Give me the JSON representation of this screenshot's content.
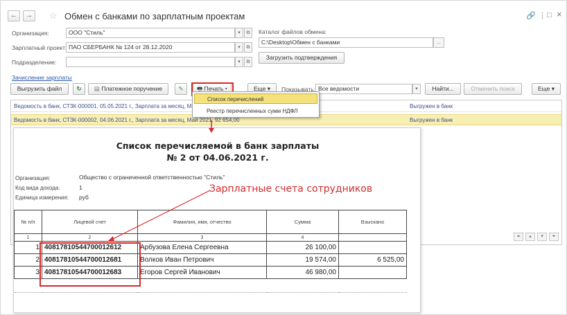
{
  "window": {
    "title": "Обмен с банками по зарплатным проектам",
    "back_icon": "←",
    "forward_icon": "→",
    "star_icon": "☆",
    "link_icon": "🔗",
    "more_icon": "⋮",
    "maximize_icon": "□",
    "close_icon": "×"
  },
  "form": {
    "org_label": "Организация:",
    "org_value": "ООО \"Стиль\"",
    "project_label": "Зарплатный проект:",
    "project_value": "ПАО СБЕРБАНК № 124 от 28.12.2020",
    "dept_label": "Подразделение:",
    "dept_value": "",
    "catalog_label": "Каталог файлов обмена:",
    "catalog_value": "C:\\Desktop\\Обмен с банками",
    "load_button": "Загрузить подтверждения",
    "section_link": "Зачисление зарплаты"
  },
  "toolbar": {
    "upload_button": "Выгрузить файл",
    "refresh_icon": "↻",
    "payment_button": "Платежное поручение",
    "edit_icon": "✎",
    "print_button": "Печать",
    "more_button": "Еще",
    "show_label": "Показывать:",
    "show_value": "Все ведомости",
    "find_button": "Найти...",
    "cancel_search_button": "Отменить поиск",
    "more_button2": "Еще"
  },
  "list": {
    "rows": [
      {
        "text": "Ведомость в банк, СТЗК-000001, 05.05.2021 г., Зарплата за месяц, Май 2021, 82 600,00",
        "status": "Выгружен в банк"
      },
      {
        "text": "Ведомость в банк, СТЗК-000002, 04.06.2021 г., Зарплата за месяц, Май 2021, 92 654,00",
        "status": "Выгружен в банк"
      }
    ]
  },
  "print_menu": {
    "items": [
      "Список перечислений",
      "Реестр перечисленных сумм НДФЛ"
    ]
  },
  "report": {
    "title_line1": "Список перечисляемой в банк зарплаты",
    "title_line2": "№  2 от 04.06.2021 г.",
    "org_label": "Организация:",
    "org_value": "Общество с ограниченной ответственностью \"Стиль\"",
    "income_label": "Код вида дохода:",
    "income_value": "1",
    "unit_label": "Единица измерения:",
    "unit_value": "руб",
    "headers": [
      "№ п/п",
      "Лицевой счет",
      "Фамилия, имя, отчество",
      "Сумма",
      "Взыскано"
    ],
    "col_numbers": [
      "1",
      "2",
      "3",
      "4",
      ""
    ],
    "rows": [
      {
        "n": "1",
        "account": "40817810544700012612",
        "name": "Арбузова Елена Сергеевна",
        "sum": "26 100,00",
        "withheld": ""
      },
      {
        "n": "2",
        "account": "40817810544700012681",
        "name": "Волков Иван Петрович",
        "sum": "19 574,00",
        "withheld": "6 525,00"
      },
      {
        "n": "3",
        "account": "40817810544700012683",
        "name": "Егоров Сергей Иванович",
        "sum": "46 980,00",
        "withheld": ""
      }
    ]
  },
  "annotation": {
    "text": "Зарплатные счета сотрудников",
    "color": "#d32a2a"
  },
  "colors": {
    "selected_row": "#f8efb4",
    "menu_highlight": "#f6e27b",
    "link": "#2a5aa8"
  }
}
